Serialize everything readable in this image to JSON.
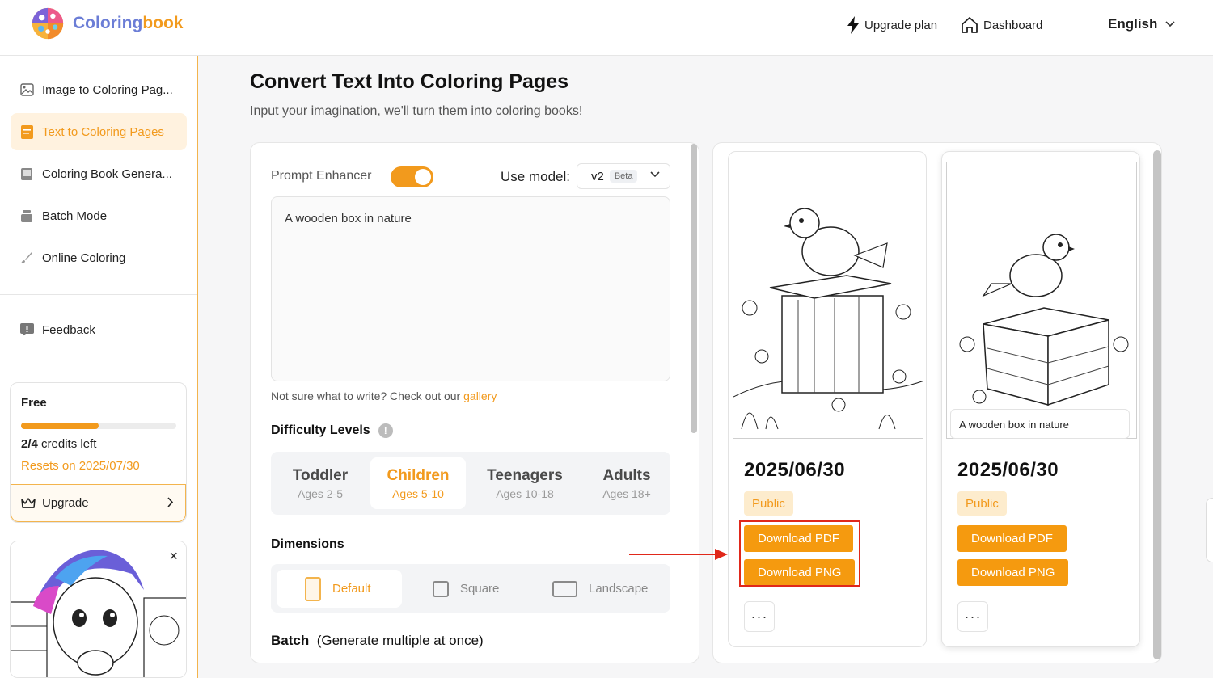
{
  "brand": {
    "name_part1": "Coloring",
    "name_part2": "book"
  },
  "header": {
    "upgrade_label": "Upgrade plan",
    "dashboard_label": "Dashboard",
    "language": "English"
  },
  "sidebar": {
    "items": [
      {
        "label": "Image to Coloring Pag...",
        "icon": "image-icon"
      },
      {
        "label": "Text to Coloring Pages",
        "icon": "document-icon",
        "active": true
      },
      {
        "label": "Coloring Book Genera...",
        "icon": "book-icon"
      },
      {
        "label": "Batch Mode",
        "icon": "stack-icon"
      },
      {
        "label": "Online Coloring",
        "icon": "brush-icon"
      }
    ],
    "feedback_label": "Feedback",
    "plan": {
      "name": "Free",
      "credits_used_fraction": 0.5,
      "credits_text": "credits left",
      "credits_value": "2/4",
      "reset_text": "Resets on 2025/07/30",
      "upgrade_label": "Upgrade"
    },
    "promo_close": "×"
  },
  "main": {
    "title": "Convert Text Into Coloring Pages",
    "subtitle": "Input your imagination, we'll turn them into coloring books!",
    "form": {
      "prompt_enhancer_label": "Prompt Enhancer",
      "prompt_enhancer_on": true,
      "model_label": "Use model:",
      "model_value": "v2",
      "model_badge": "Beta",
      "prompt_text": "A wooden box in nature",
      "hint_prefix": "Not sure what to write? Check out our",
      "hint_link": "gallery",
      "difficulty_title": "Difficulty Levels",
      "difficulty_info": "!",
      "difficulty": [
        {
          "name": "Toddler",
          "ages": "Ages 2-5"
        },
        {
          "name": "Children",
          "ages": "Ages 5-10",
          "active": true
        },
        {
          "name": "Teenagers",
          "ages": "Ages 10-18"
        },
        {
          "name": "Adults",
          "ages": "Ages 18+"
        }
      ],
      "dimensions_title": "Dimensions",
      "dimensions": [
        {
          "name": "Default",
          "active": true
        },
        {
          "name": "Square"
        },
        {
          "name": "Landscape"
        }
      ],
      "batch_title": "Batch",
      "batch_note": "(Generate multiple at once)"
    },
    "results": [
      {
        "date": "2025/06/30",
        "visibility": "Public",
        "download_pdf": "Download PDF",
        "download_png": "Download PNG",
        "more": "···"
      },
      {
        "date": "2025/06/30",
        "visibility": "Public",
        "caption": "A wooden box in nature",
        "download_pdf": "Download PDF",
        "download_png": "Download PNG",
        "more": "···"
      }
    ]
  },
  "colors": {
    "accent": "#f29a1d",
    "button": "#f59a0f",
    "annotation": "#e0281a"
  }
}
